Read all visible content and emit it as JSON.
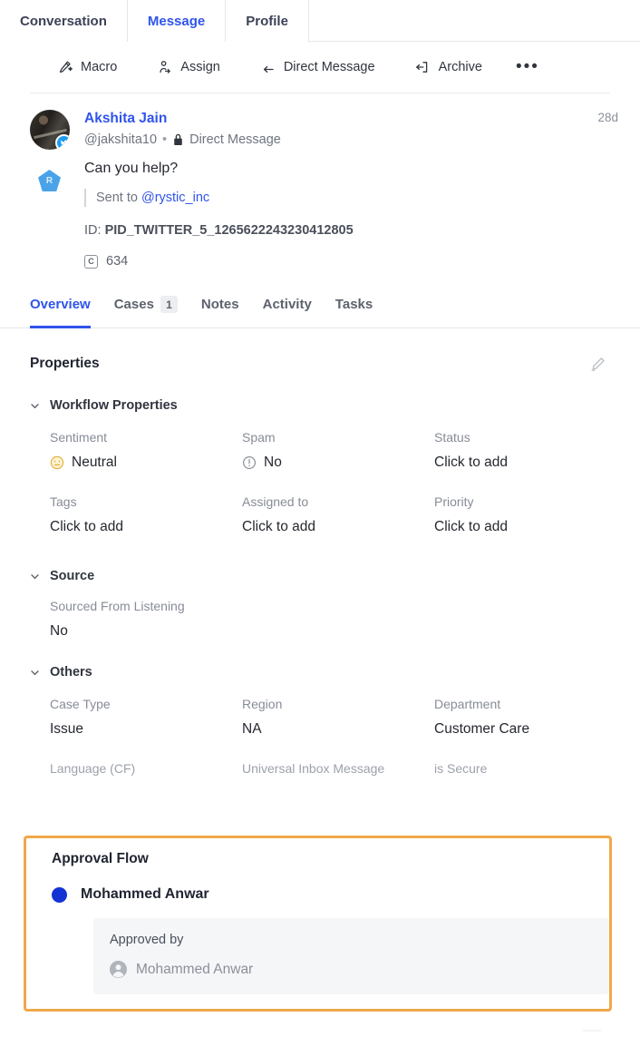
{
  "top_tabs": [
    {
      "label": "Conversation",
      "active": false
    },
    {
      "label": "Message",
      "active": true
    },
    {
      "label": "Profile",
      "active": false
    }
  ],
  "toolbar": {
    "actions": [
      {
        "label": "Macro",
        "icon": "magic-wand-icon"
      },
      {
        "label": "Assign",
        "icon": "assign-user-icon"
      },
      {
        "label": "Direct Message",
        "icon": "reply-arrow-icon"
      },
      {
        "label": "Archive",
        "icon": "archive-icon"
      }
    ],
    "more_label": "•••"
  },
  "message": {
    "author_name": "Akshita Jain",
    "handle": "@jakshita10",
    "separator": "•",
    "channel_type": "Direct Message",
    "timestamp": "28d",
    "body": "Can you help?",
    "sent_to_prefix": "Sent to",
    "sent_to_handle": "@rystic_inc",
    "id_label": "ID:",
    "id_value": "PID_TWITTER_5_1265622243230412805",
    "char_badge": "C",
    "char_count": "634",
    "brand_chip": "R",
    "avatar_network": "twitter-icon",
    "lock_icon": "lock-icon"
  },
  "sub_tabs": [
    {
      "label": "Overview",
      "badge": null,
      "active": true
    },
    {
      "label": "Cases",
      "badge": "1",
      "active": false
    },
    {
      "label": "Notes",
      "badge": null,
      "active": false
    },
    {
      "label": "Activity",
      "badge": null,
      "active": false
    },
    {
      "label": "Tasks",
      "badge": null,
      "active": false
    }
  ],
  "properties": {
    "title": "Properties",
    "edit_icon": "pencil-edit-icon",
    "groups": [
      {
        "title": "Workflow Properties",
        "fields": [
          {
            "label": "Sentiment",
            "value": "Neutral",
            "icon": "neutral-face-icon"
          },
          {
            "label": "Spam",
            "value": "No",
            "icon": "exclamation-circle-icon"
          },
          {
            "label": "Status",
            "value": "Click to add",
            "icon": null
          },
          {
            "label": "Tags",
            "value": "Click to add",
            "icon": null
          },
          {
            "label": "Assigned to",
            "value": "Click to add",
            "icon": null
          },
          {
            "label": "Priority",
            "value": "Click to add",
            "icon": null
          }
        ]
      },
      {
        "title": "Source",
        "fields": [
          {
            "label": "Sourced From Listening",
            "value": "No",
            "icon": null
          }
        ]
      },
      {
        "title": "Others",
        "fields": [
          {
            "label": "Case Type",
            "value": "Issue",
            "icon": null
          },
          {
            "label": "Region",
            "value": "NA",
            "icon": null
          },
          {
            "label": "Department",
            "value": "Customer Care",
            "icon": null
          }
        ],
        "label_only_fields": [
          {
            "label": "Language (CF)"
          },
          {
            "label": "Universal Inbox Message"
          },
          {
            "label": "is Secure"
          }
        ]
      }
    ]
  },
  "approval_flow": {
    "title": "Approval Flow",
    "node_name": "Mohammed Anwar",
    "card_label": "Approved by",
    "approver_name": "Mohammed Anwar",
    "approver_icon": "person-circle-icon",
    "highlight_color": "#f0a84a",
    "node_dot_color": "#1433d4"
  }
}
